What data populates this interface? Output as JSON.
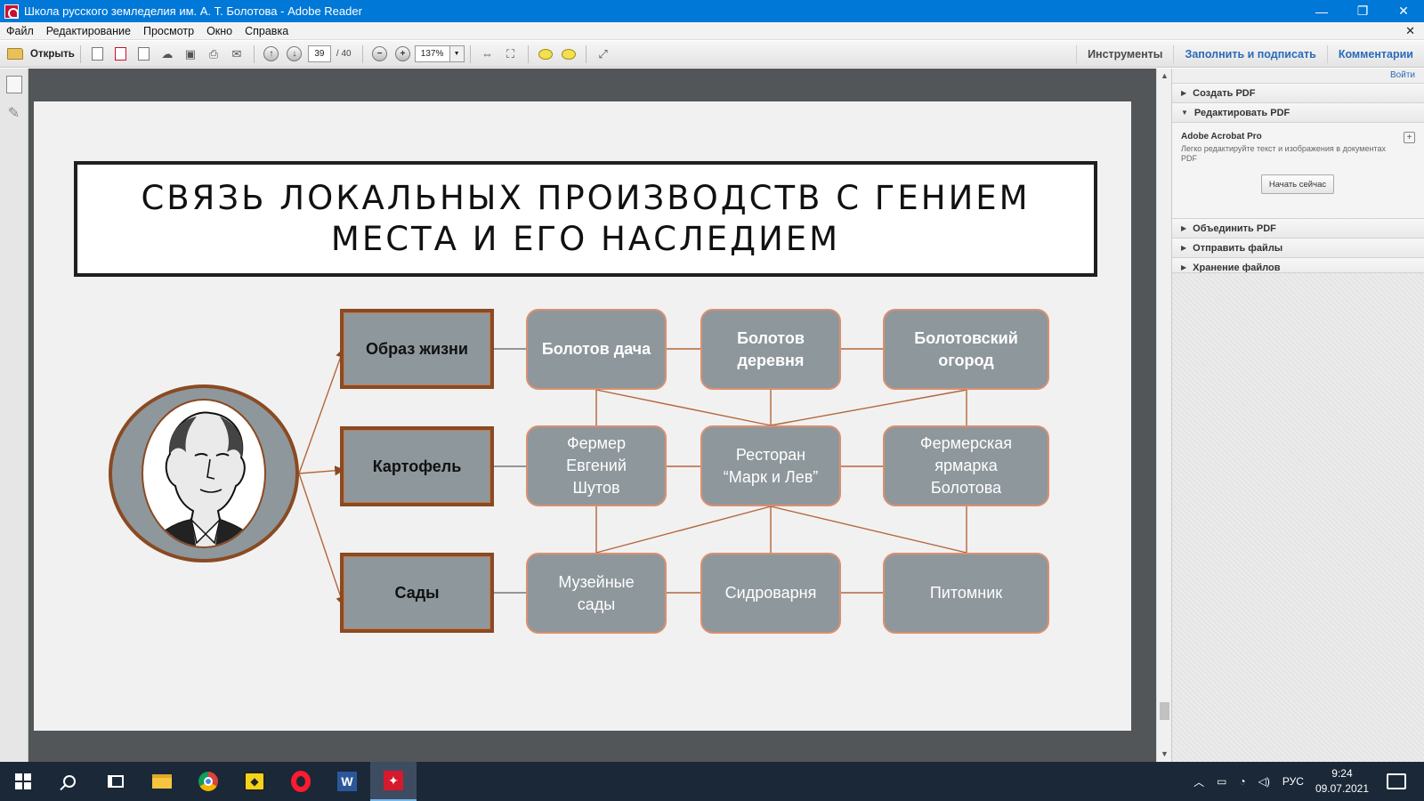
{
  "window": {
    "title": "Школа русского земледелия им. А. Т. Болотова - Adobe Reader",
    "minimize": "—",
    "restore": "❐",
    "close": "✕"
  },
  "menu": {
    "items": [
      "Файл",
      "Редактирование",
      "Просмотр",
      "Окно",
      "Справка"
    ],
    "close": "✕"
  },
  "toolbar": {
    "open_label": "Открыть",
    "page_current": "39",
    "page_total": "/ 40",
    "zoom": "137%",
    "tools_label": "Инструменты",
    "fill_sign_label": "Заполнить и подписать",
    "comments_label": "Комментарии"
  },
  "slide": {
    "title": "СВЯЗЬ ЛОКАЛЬНЫХ ПРОИЗВОДСТВ С ГЕНИЕМ МЕСТА И ЕГО НАСЛЕДИЕМ",
    "categories": [
      "Образ жизни",
      "Картофель",
      "Сады"
    ],
    "row1": [
      "Болотов дача",
      "Болотов деревня",
      "Болотовский огород"
    ],
    "row2": [
      "Фермер Евгений Шутов",
      "Ресторан “Марк и Лев”",
      "Фермерская ярмарка Болотова"
    ],
    "row3": [
      "Музейные сады",
      "Сидроварня",
      "Питомник"
    ]
  },
  "right_panel": {
    "login": "Войти",
    "create_pdf": "Создать PDF",
    "edit_pdf": "Редактировать PDF",
    "product": "Adobe Acrobat Pro",
    "product_desc": "Легко редактируйте текст и изображения в документах PDF",
    "start_button": "Начать сейчас",
    "combine_pdf": "Объединить PDF",
    "send_files": "Отправить файлы",
    "store_files": "Хранение файлов"
  },
  "taskbar": {
    "language": "РУС",
    "time": "9:24",
    "date": "09.07.2021"
  },
  "colors": {
    "titlebar": "#0078d7",
    "box_fill": "#8e979c",
    "box_border": "#8a4a22",
    "connector": "#b5653a"
  }
}
